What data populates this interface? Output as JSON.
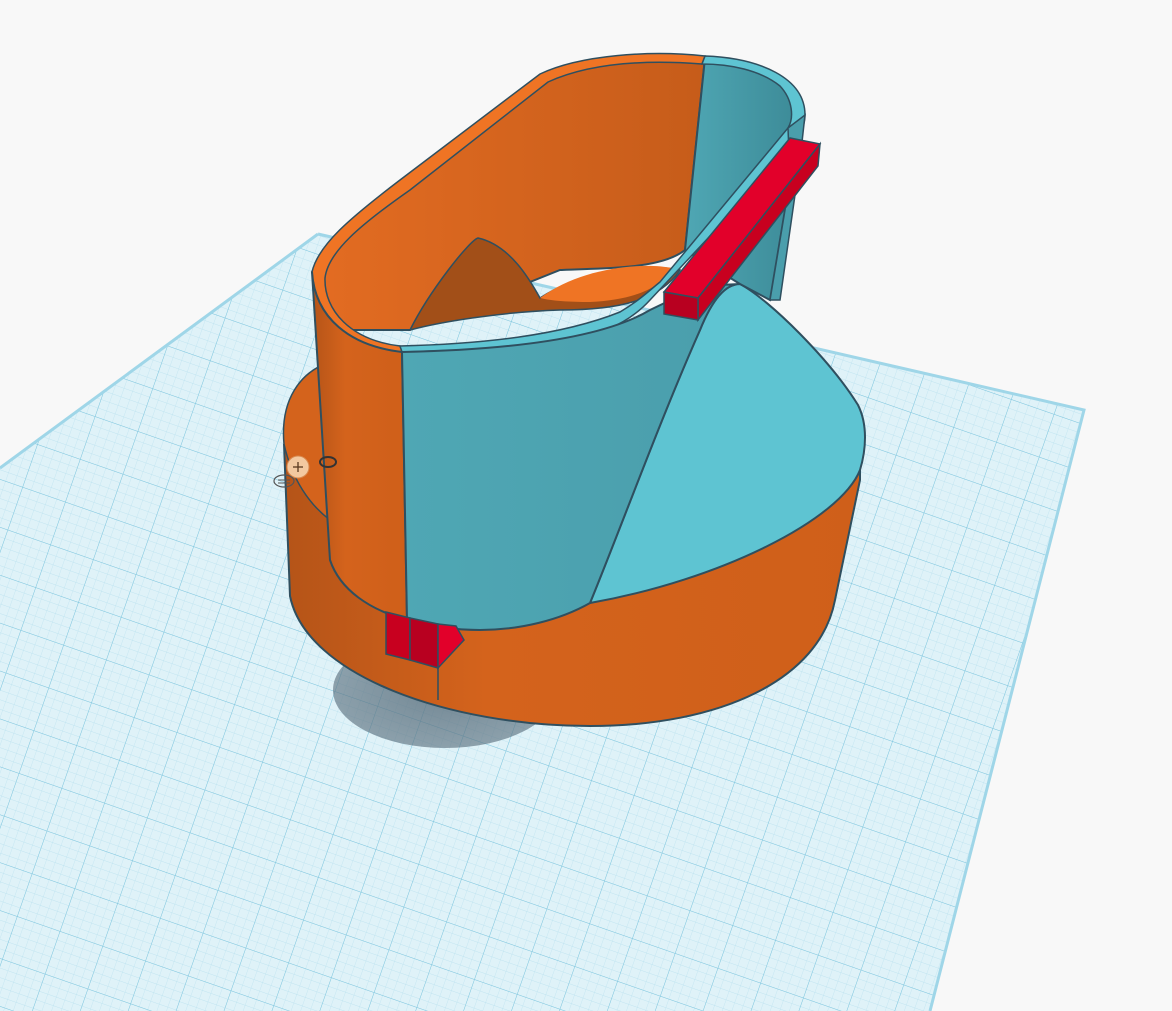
{
  "app": {
    "view": "3d-workplane"
  },
  "colors": {
    "background": "#f8f8f8",
    "workplane_fill": "#dff2f8",
    "grid_minor": "#b6e0ee",
    "grid_major": "#7fc6de",
    "orange_light": "#ef7424",
    "orange_mid": "#d4631c",
    "orange_dark": "#b55418",
    "teal_light": "#5ec4d2",
    "teal_mid": "#4fa7b4",
    "teal_dark": "#3c8a97",
    "red": "#e2002a",
    "red_dark": "#b80020",
    "outline": "#2f4f5f",
    "shadow": "#6a7e8c"
  },
  "scene": {
    "objects": [
      {
        "name": "base-cylinder",
        "color": "orange",
        "selected": false
      },
      {
        "name": "oval-container",
        "color": "orange-teal",
        "selected": false
      },
      {
        "name": "cone-flare",
        "color": "teal",
        "selected": false
      },
      {
        "name": "red-bar-top",
        "color": "red",
        "selected": false
      },
      {
        "name": "red-blocks-bottom",
        "color": "red",
        "selected": false
      }
    ],
    "view_controls": [
      {
        "name": "home-view-control",
        "icon": "plus-icon"
      },
      {
        "name": "orbit-control",
        "icon": "ring-icon"
      },
      {
        "name": "zoom-control",
        "icon": "stack-icon"
      }
    ]
  }
}
